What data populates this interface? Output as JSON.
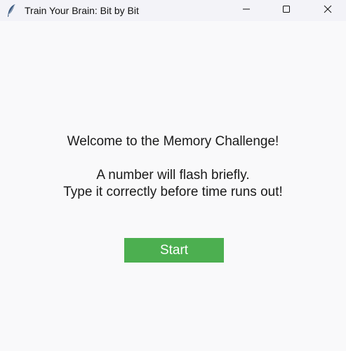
{
  "window": {
    "title": "Train Your Brain: Bit by Bit",
    "app_icon": "feather-icon",
    "controls": {
      "minimize_icon": "minimize-icon",
      "maximize_icon": "maximize-icon",
      "close_icon": "close-icon"
    }
  },
  "main": {
    "welcome": "Welcome to the Memory Challenge!",
    "instruction_line1": "A number will flash briefly.",
    "instruction_line2": "Type it correctly before time runs out!",
    "start_label": "Start"
  },
  "colors": {
    "background": "#f9f9fa",
    "titlebar": "#f3f3f8",
    "start_button": "#4caf50",
    "start_text": "#ffffff"
  }
}
